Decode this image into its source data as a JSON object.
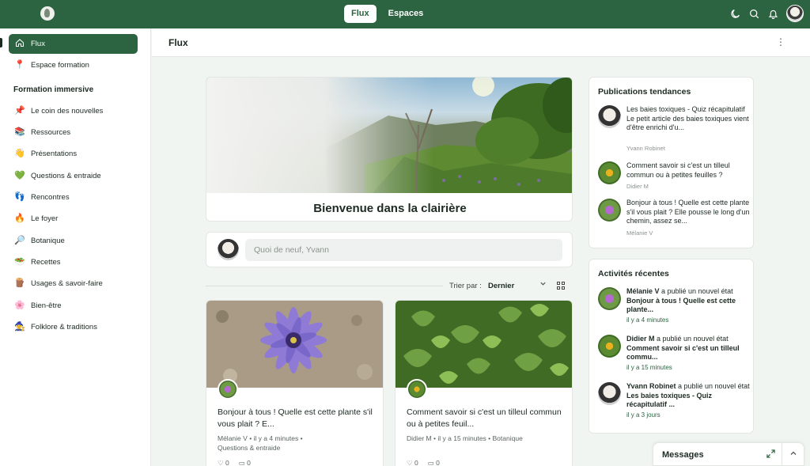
{
  "topbar": {
    "tabs": [
      {
        "label": "Flux",
        "active": true
      },
      {
        "label": "Espaces",
        "active": false
      }
    ],
    "icons": [
      "moon-icon",
      "search-icon",
      "bell-icon",
      "user-avatar"
    ]
  },
  "sidebar": {
    "items": [
      {
        "label": "Flux",
        "icon": "home-icon",
        "glyph": "⌂",
        "active": true
      },
      {
        "label": "Espace formation",
        "icon": "map-pin-icon",
        "glyph": "📍",
        "active": false
      }
    ],
    "section_title": "Formation immersive",
    "section_items": [
      {
        "label": "Le coin des nouvelles",
        "icon": "pushpin-icon",
        "glyph": "📌"
      },
      {
        "label": "Ressources",
        "icon": "books-icon",
        "glyph": "📚"
      },
      {
        "label": "Présentations",
        "icon": "wave-hand-icon",
        "glyph": "👋"
      },
      {
        "label": "Questions & entraide",
        "icon": "green-heart-icon",
        "glyph": "💚"
      },
      {
        "label": "Rencontres",
        "icon": "footprints-icon",
        "glyph": "👣"
      },
      {
        "label": "Le foyer",
        "icon": "fire-icon",
        "glyph": "🔥"
      },
      {
        "label": "Botanique",
        "icon": "magnifier-icon",
        "glyph": "🔎"
      },
      {
        "label": "Recettes",
        "icon": "salad-icon",
        "glyph": "🥗"
      },
      {
        "label": "Usages & savoir-faire",
        "icon": "wood-icon",
        "glyph": "🪵"
      },
      {
        "label": "Bien-être",
        "icon": "blossom-icon",
        "glyph": "🌸"
      },
      {
        "label": "Folklore & traditions",
        "icon": "person-icon",
        "glyph": "🧙"
      }
    ]
  },
  "header": {
    "title": "Flux"
  },
  "hero": {
    "title": "Bienvenue dans la clairière"
  },
  "composer": {
    "placeholder": "Quoi de neuf, Yvann"
  },
  "sort": {
    "label": "Trier par :",
    "value": "Dernier"
  },
  "posts": [
    {
      "title": "Bonjour à tous ! Quelle est cette plante s'il vous plait ? E...",
      "author": "Mélanie V",
      "time": "il y a 4 minutes",
      "space": "Questions & entraide",
      "likes": "0",
      "comments": "0"
    },
    {
      "title": "Comment savoir si c'est un tilleul commun ou à petites feuil...",
      "author": "Didier M",
      "time": "il y a 15 minutes",
      "space": "Botanique",
      "likes": "0",
      "comments": "0"
    }
  ],
  "trending": {
    "title": "Publications tendances",
    "items": [
      {
        "text": "Les baies toxiques - Quiz récapitulatif Le petit article des baies toxiques vient d'être enrichi d'u...",
        "author": "Yvann Robinet"
      },
      {
        "text": "Comment savoir si c'est un tilleul commun ou à petites feuilles ?",
        "author": "Didier M"
      },
      {
        "text": "Bonjour à tous ! Quelle est cette plante s'il vous plait ? Elle pousse le long d'un chemin, assez se...",
        "author": "Mélanie V"
      }
    ]
  },
  "recent": {
    "title": "Activités récentes",
    "items": [
      {
        "actor": "Mélanie V",
        "action": " a publié un nouvel état ",
        "subject": "Bonjour à tous ! Quelle est cette plante...",
        "time": "il y a 4 minutes"
      },
      {
        "actor": "Didier M",
        "action": " a publié un nouvel état ",
        "subject": "Comment savoir si c'est un tilleul commu...",
        "time": "il y a 15 minutes"
      },
      {
        "actor": "Yvann Robinet",
        "action": " a publié un nouvel état ",
        "subject": "Les baies toxiques - Quiz récapitulatif ...",
        "time": "il y a 3 jours"
      }
    ]
  },
  "messages": {
    "title": "Messages"
  }
}
